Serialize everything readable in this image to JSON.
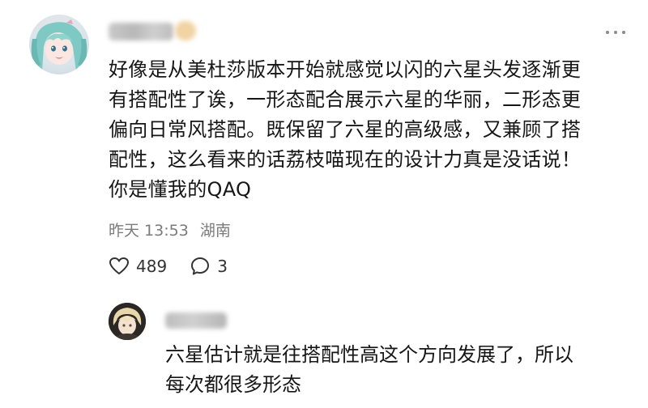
{
  "comment": {
    "lines": [
      "好像是从美杜莎版本开始就感觉以闪的六星头发逐渐更",
      "有搭配性了诶，一形态配合展示六星的华丽，二形态更",
      "偏向日常风搭配。既保留了六星的高级感，又兼顾了搭",
      "配性，这么看来的话荔枝喵现在的设计力真是没话说！",
      "你是懂我的QAQ"
    ],
    "time": "昨天 13:53",
    "location": "湖南",
    "like_count": "489",
    "reply_count": "3",
    "icons": {
      "more": "more-dots-icon",
      "like": "heart-icon",
      "reply": "comment-bubble-icon"
    }
  },
  "reply": {
    "lines": [
      "六星估计就是往搭配性高这个方向发展了，所以",
      "每次都很多形态"
    ]
  },
  "colors": {
    "text": "#161616",
    "meta": "#7b7b7b",
    "background": "#ffffff"
  }
}
